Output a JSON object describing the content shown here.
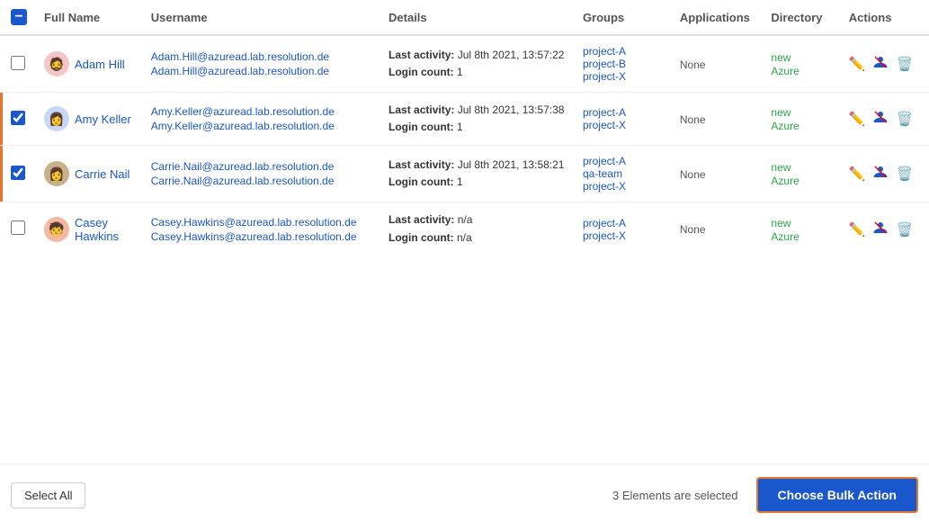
{
  "table": {
    "header": {
      "checkbox_state": "minus",
      "columns": [
        "Full Name",
        "Username",
        "Details",
        "Groups",
        "Applications",
        "Directory",
        "Actions"
      ]
    },
    "rows": [
      {
        "id": "adam-hill",
        "selected": false,
        "avatar_emoji": "🧔",
        "avatar_bg": "#f4c6c6",
        "full_name": "Adam Hill",
        "username_display": "Adam.Hill@azuread.lab.resolution.de",
        "username_link": "Adam.Hill@azuread.lab.resolution.de",
        "details_activity": "Last activity: Jul 8th 2021, 13:57:22",
        "details_login": "Login count: 1",
        "groups": [
          "project-A",
          "project-B",
          "project-X"
        ],
        "applications": "None",
        "directory": "new Azure",
        "actions": [
          "edit",
          "block",
          "delete"
        ]
      },
      {
        "id": "amy-keller",
        "selected": true,
        "avatar_emoji": "👩",
        "avatar_bg": "#c6d8f4",
        "full_name": "Amy Keller",
        "username_display": "Amy.Keller@azuread.lab.resolution.de",
        "username_link": "Amy.Keller@azuread.lab.resolution.de",
        "details_activity": "Last activity: Jul 8th 2021, 13:57:38",
        "details_login": "Login count: 1",
        "groups": [
          "project-A",
          "project-X"
        ],
        "applications": "None",
        "directory": "new Azure",
        "actions": [
          "edit",
          "block",
          "delete"
        ]
      },
      {
        "id": "carrie-nail",
        "selected": true,
        "avatar_emoji": "👩",
        "avatar_bg": "#c8b08a",
        "full_name": "Carrie Nail",
        "username_display": "Carrie.Nail@azuread.lab.resolution.de",
        "username_link": "Carrie.Nail@azuread.lab.resolution.de",
        "details_activity": "Last activity: Jul 8th 2021, 13:58:21",
        "details_login": "Login count: 1",
        "groups": [
          "project-A",
          "qa-team",
          "project-X"
        ],
        "applications": "None",
        "directory": "new Azure",
        "actions": [
          "edit",
          "block",
          "delete"
        ]
      },
      {
        "id": "casey-hawkins",
        "selected": false,
        "avatar_emoji": "🧒",
        "avatar_bg": "#f4b8a0",
        "full_name": "Casey Hawkins",
        "username_display": "Casey.Hawkins@azuread.lab.resolution.de",
        "username_link": "Casey.Hawkins@azuread.lab.resolution.de",
        "details_activity": "Last activity: n/a",
        "details_login": "Login count: n/a",
        "groups": [
          "project-A",
          "project-X"
        ],
        "applications": "None",
        "directory": "new Azure",
        "actions": [
          "edit",
          "block",
          "delete"
        ]
      }
    ]
  },
  "footer": {
    "select_all_label": "Select All",
    "elements_selected_text": "3 Elements are selected",
    "bulk_action_label": "Choose Bulk Action"
  }
}
